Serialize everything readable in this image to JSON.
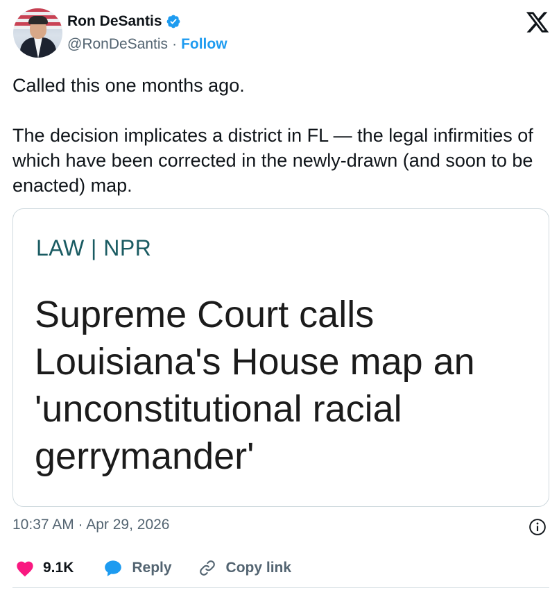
{
  "author": {
    "name": "Ron DeSantis",
    "handle": "@RonDeSantis",
    "separator": "·",
    "follow_label": "Follow"
  },
  "tweet": {
    "paragraphs": [
      "Called this one months ago.",
      "The decision implicates a district in FL — the legal infirmities of which have been corrected in the newly-drawn (and soon to be enacted) map."
    ],
    "timestamp": "10:37 AM · Apr 29, 2026"
  },
  "card": {
    "kicker": "LAW | NPR",
    "title": "Supreme Court calls Louisiana's House map an 'unconstitutional racial gerrymander'"
  },
  "actions": {
    "like_count": "9.1K",
    "reply_label": "Reply",
    "copy_label": "Copy link"
  },
  "colors": {
    "accent": "#1d9bf0",
    "like": "#f91880",
    "muted": "#536471",
    "kicker": "#1a5b62"
  },
  "icons": [
    "verified-badge-icon",
    "x-logo-icon",
    "info-icon",
    "heart-icon",
    "reply-bubble-icon",
    "link-icon"
  ]
}
